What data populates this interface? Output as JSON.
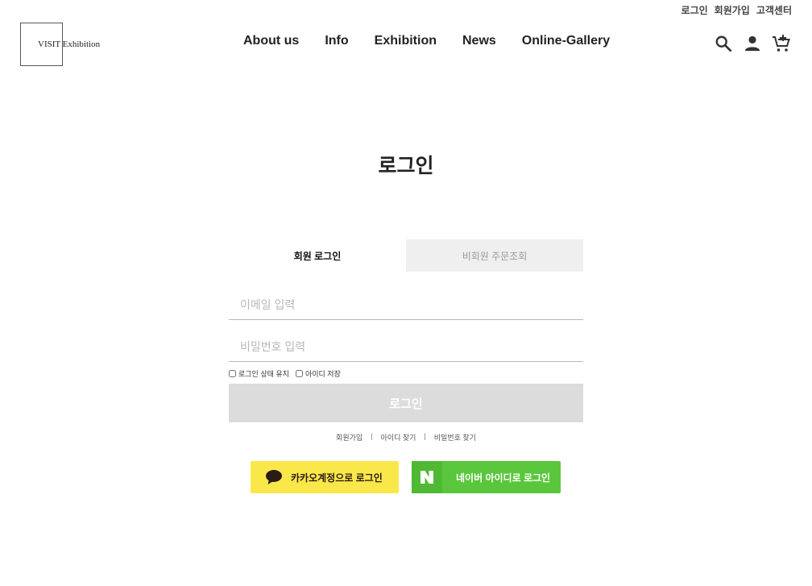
{
  "top_links": {
    "login": "로그인",
    "join": "회원가입",
    "cs": "고객센터"
  },
  "logo": {
    "text": "VISIT Exhibition"
  },
  "nav": {
    "about": "About us",
    "info": "Info",
    "exhibition": "Exhibition",
    "news": "News",
    "gallery": "Online-Gallery"
  },
  "icons": {
    "search": "search-icon",
    "user": "user-icon",
    "cart": "cart-icon"
  },
  "page": {
    "title": "로그인"
  },
  "tabs": {
    "member": "회원 로그인",
    "guest": "비회원 주문조회"
  },
  "form": {
    "email_placeholder": "이메일 입력",
    "password_placeholder": "비밀번호 입력",
    "keep_login": "로그인 상태 유지",
    "save_id": "아이디 저장",
    "submit": "로그인"
  },
  "sub_links": {
    "join": "회원가입",
    "find_id": "아이디 찾기",
    "find_pw": "비밀번호 찾기",
    "sep": "|"
  },
  "social": {
    "kakao": "카카오계정으로 로그인",
    "naver": "네이버 아이디로 로그인",
    "naver_logo": "N"
  },
  "colors": {
    "kakao": "#fae84a",
    "naver": "#5ac63c",
    "button_disabled": "#dcdcdc",
    "tab_inactive": "#efefef"
  }
}
